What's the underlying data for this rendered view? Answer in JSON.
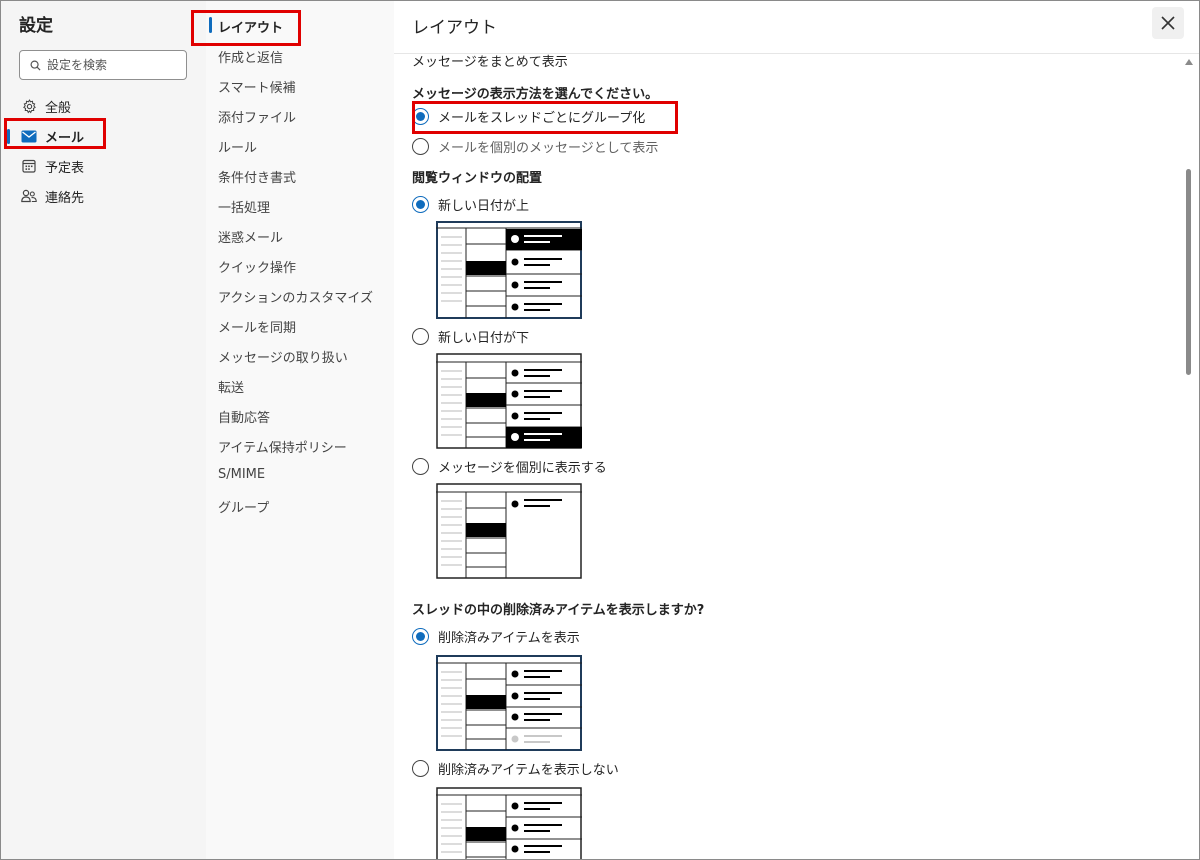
{
  "sidebar": {
    "title": "設定",
    "search_placeholder": "設定を検索",
    "items": [
      {
        "label": "全般",
        "icon": "gear-icon"
      },
      {
        "label": "メール",
        "icon": "mail-icon"
      },
      {
        "label": "予定表",
        "icon": "calendar-icon"
      },
      {
        "label": "連絡先",
        "icon": "people-icon"
      }
    ]
  },
  "subnav": {
    "items": [
      "レイアウト",
      "作成と返信",
      "スマート候補",
      "添付ファイル",
      "ルール",
      "条件付き書式",
      "一括処理",
      "迷惑メール",
      "クイック操作",
      "アクションのカスタマイズ",
      "メールを同期",
      "メッセージの取り扱い",
      "転送",
      "自動応答",
      "アイテム保持ポリシー",
      "S/MIME",
      "グループ"
    ]
  },
  "content": {
    "title": "レイアウト",
    "close_icon": "close-icon",
    "group_heading": "メッセージをまとめて表示",
    "group_question": "メッセージの表示方法を選んでください。",
    "group_options": [
      "メールをスレッドごとにグループ化",
      "メールを個別のメッセージとして表示"
    ],
    "group_selected": 0,
    "pane_heading": "閲覧ウィンドウの配置",
    "pane_options": [
      "新しい日付が上",
      "新しい日付が下",
      "メッセージを個別に表示する"
    ],
    "pane_selected": 0,
    "deleted_heading": "スレッドの中の削除済みアイテムを表示しますか?",
    "deleted_options": [
      "削除済みアイテムを表示",
      "削除済みアイテムを表示しない"
    ],
    "deleted_selected": 0
  },
  "colors": {
    "accent": "#0f6cbd",
    "highlight": "#e00000",
    "sidebar_bg": "#f5f5f5"
  }
}
